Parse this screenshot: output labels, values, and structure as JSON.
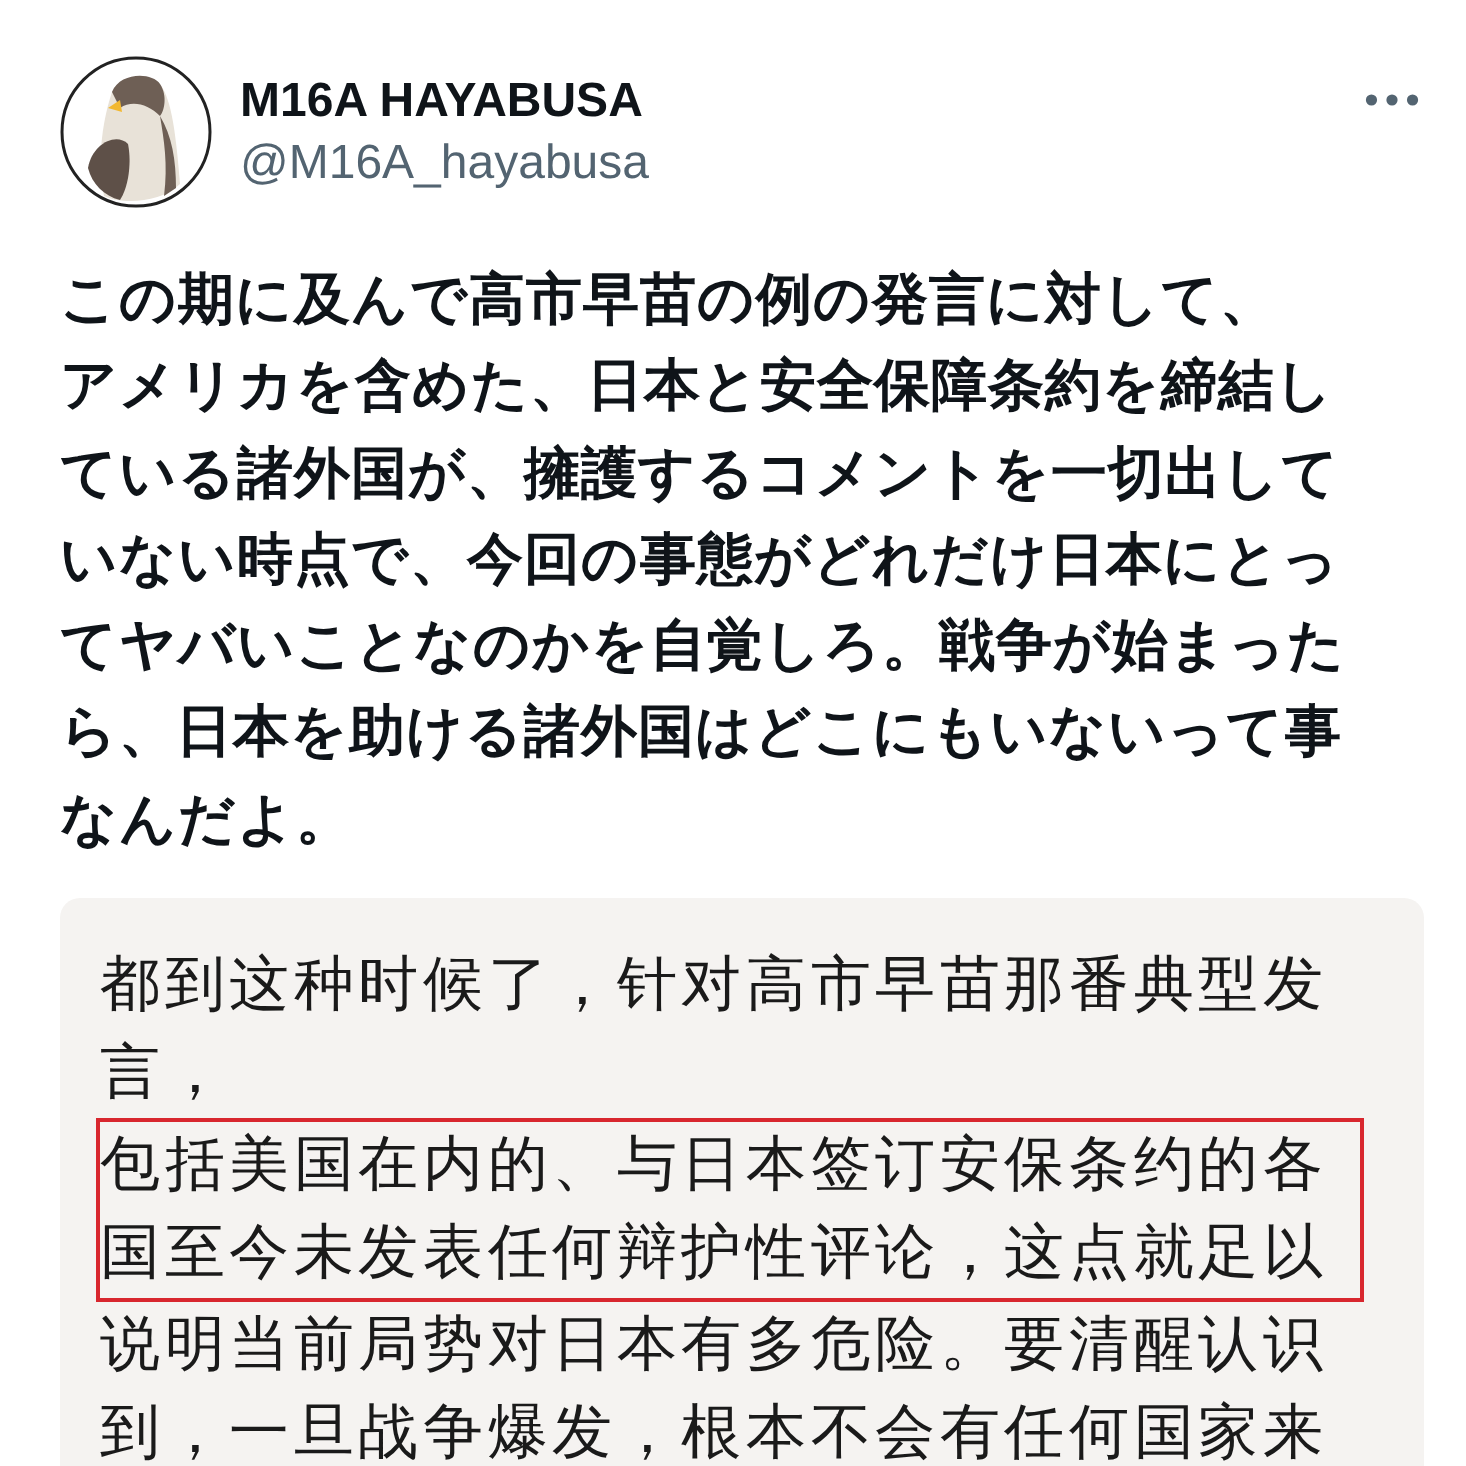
{
  "author": {
    "name": "M16A HAYABUSA",
    "handle": "@M16A_hayabusa"
  },
  "post_lines": [
    "この期に及んで高市早苗の例の発言に対して、",
    "アメリカを含めた、日本と安全保障条約を締結し",
    "ている諸外国が、擁護するコメントを一切出して",
    "いない時点で、今回の事態がどれだけ日本にとっ",
    "てヤバいことなのかを自覚しろ。戦争が始まった",
    "ら、日本を助ける諸外国はどこにもいないって事",
    "なんだよ。"
  ],
  "translation_lines": [
    {
      "text": "都到这种时候了，针对高市早苗那番典型发",
      "highlighted": false
    },
    {
      "text": "言，",
      "highlighted": false
    },
    {
      "text": "包括美国在内的、与日本签订安保条约的各",
      "highlighted": true
    },
    {
      "text": "国至今未发表任何辩护性评论，这点就足以",
      "highlighted": true
    },
    {
      "text": "说明当前局势对日本有多危险。要清醒认识",
      "highlighted": false
    },
    {
      "text": "到，一旦战争爆发，根本不会有任何国家来",
      "highlighted": false
    }
  ]
}
